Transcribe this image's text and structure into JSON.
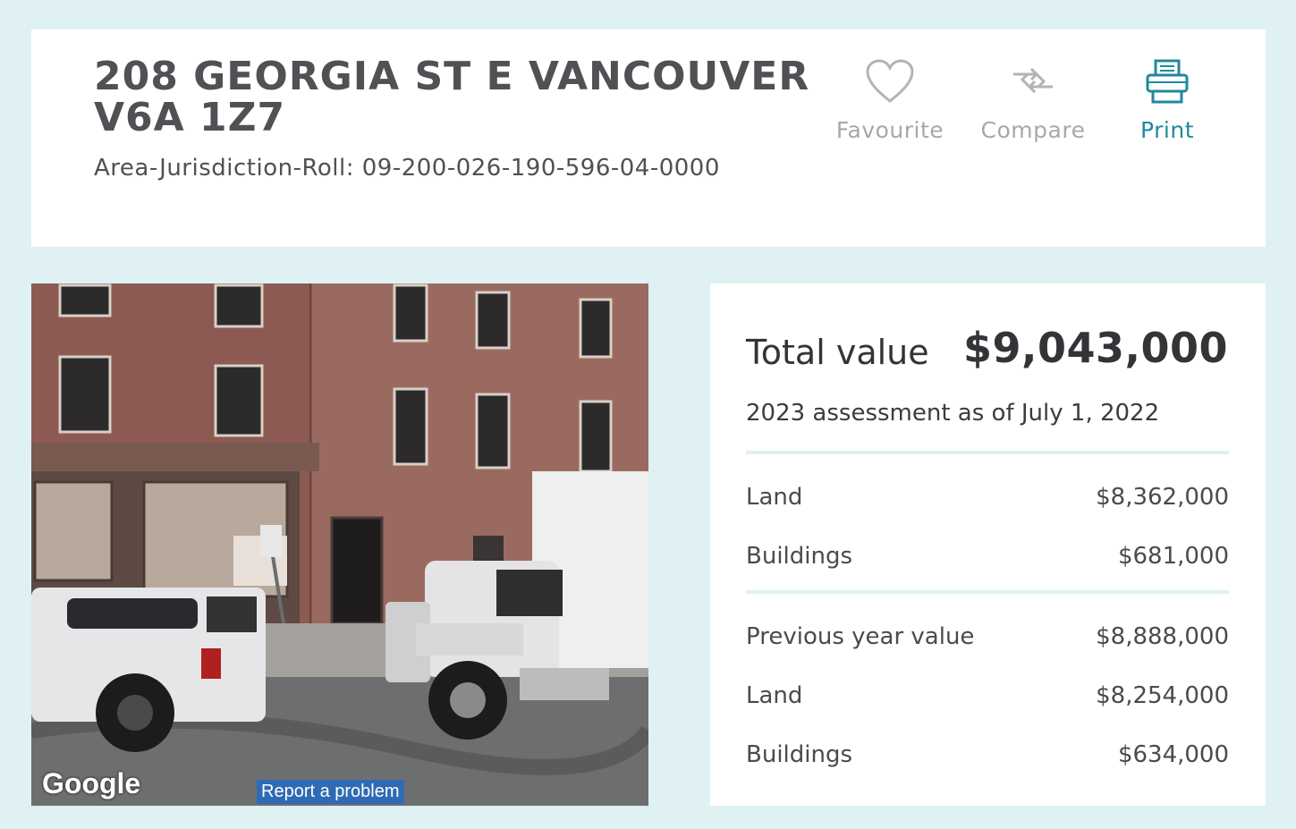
{
  "property": {
    "address": "208 GEORGIA ST E VANCOUVER V6A 1Z7",
    "roll": "Area-Jurisdiction-Roll: 09-200-026-190-596-04-0000"
  },
  "actions": {
    "favourite": "Favourite",
    "compare": "Compare",
    "print": "Print"
  },
  "photo": {
    "logo": "Google",
    "report_link": "Report a problem"
  },
  "valuation": {
    "total_label": "Total value",
    "total_value": "$9,043,000",
    "assessment_date": "2023 assessment as of July 1, 2022",
    "current": [
      {
        "label": "Land",
        "value": "$8,362,000"
      },
      {
        "label": "Buildings",
        "value": "$681,000"
      }
    ],
    "previous": [
      {
        "label": "Previous year value",
        "value": "$8,888,000"
      },
      {
        "label": "Land",
        "value": "$8,254,000"
      },
      {
        "label": "Buildings",
        "value": "$634,000"
      }
    ]
  },
  "colors": {
    "background": "#dff1f2",
    "accent": "#1f8a9c",
    "muted": "#a8a8ac"
  }
}
